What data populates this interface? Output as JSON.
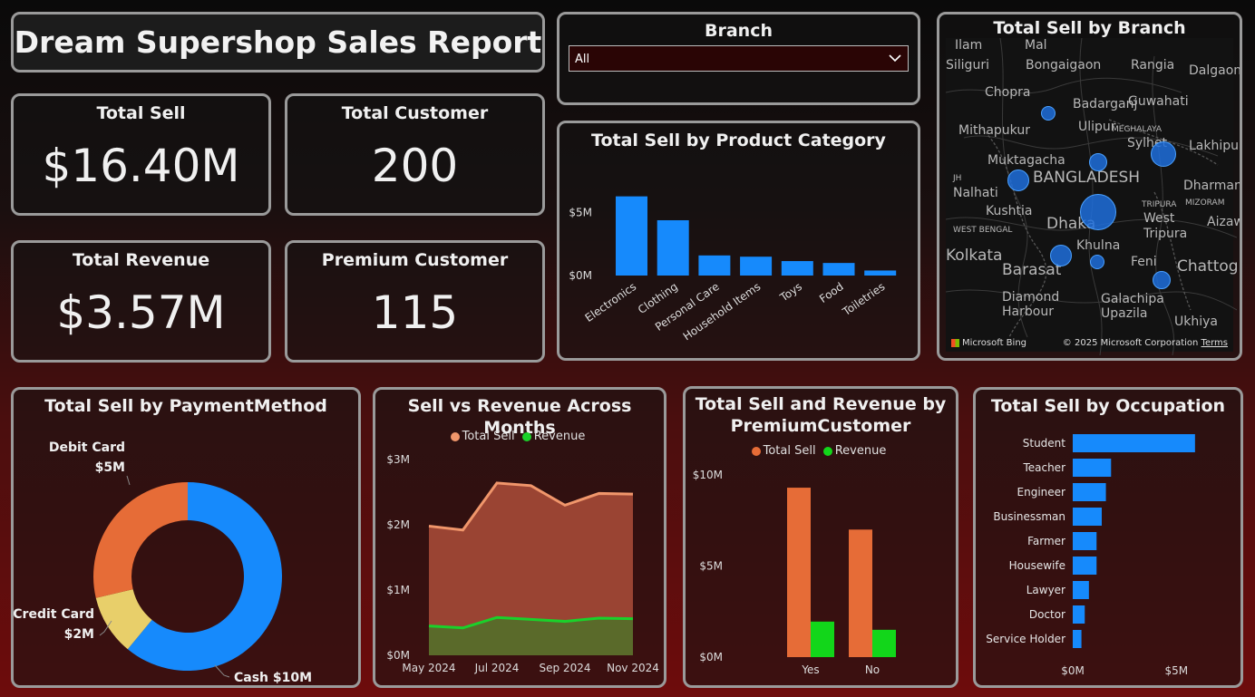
{
  "report": {
    "title": "Dream Supershop Sales Report"
  },
  "kpis": {
    "total_sell": {
      "label": "Total Sell",
      "value": "$16.40M"
    },
    "total_customer": {
      "label": "Total Customer",
      "value": "200"
    },
    "total_revenue": {
      "label": "Total Revenue",
      "value": "$3.57M"
    },
    "premium_customer": {
      "label": "Premium Customer",
      "value": "115"
    }
  },
  "branch_slicer": {
    "label": "Branch",
    "selected": "All",
    "icon": "chevron-down-icon"
  },
  "map": {
    "title": "Total Sell by Branch",
    "places": [
      {
        "name": "Ilam"
      },
      {
        "name": "Mal"
      },
      {
        "name": "Siliguri"
      },
      {
        "name": "Bongaigaon"
      },
      {
        "name": "Rangia"
      },
      {
        "name": "Dalgaon"
      },
      {
        "name": "Chopra"
      },
      {
        "name": "Badarganj"
      },
      {
        "name": "Guwahati"
      },
      {
        "name": "Mithapukur"
      },
      {
        "name": "Ulipur"
      },
      {
        "name": "MEGHALAYA"
      },
      {
        "name": "Sylhet"
      },
      {
        "name": "Lakhipur"
      },
      {
        "name": "JH"
      },
      {
        "name": "Muktagacha"
      },
      {
        "name": "BANGLADESH"
      },
      {
        "name": "Nalhati"
      },
      {
        "name": "Dharmana"
      },
      {
        "name": "MIZORAM"
      },
      {
        "name": "Kushtia"
      },
      {
        "name": "TRIPURA"
      },
      {
        "name": "WEST BENGAL"
      },
      {
        "name": "Dhaka"
      },
      {
        "name": "West"
      },
      {
        "name": "Tripura"
      },
      {
        "name": "Aizaw"
      },
      {
        "name": "Khulna"
      },
      {
        "name": "Kolkata"
      },
      {
        "name": "Barasat"
      },
      {
        "name": "Feni"
      },
      {
        "name": "Chattogra"
      },
      {
        "name": "Diamond"
      },
      {
        "name": "Harbour"
      },
      {
        "name": "Galachipa"
      },
      {
        "name": "Upazila"
      },
      {
        "name": "Ukhiya"
      }
    ],
    "attribution_logo": "Microsoft Bing",
    "copyright": "© 2025 Microsoft Corporation",
    "terms": "Terms"
  },
  "chart_data": [
    {
      "id": "category",
      "type": "bar",
      "title": "Total Sell by Product Category",
      "categories": [
        "Electronics",
        "Clothing",
        "Personal Care",
        "Household Items",
        "Toys",
        "Food",
        "Toiletries"
      ],
      "values": [
        6.3,
        4.4,
        1.6,
        1.5,
        1.15,
        1.0,
        0.4
      ],
      "unit": "M",
      "ylim": [
        0,
        7.5
      ],
      "yticks": [
        "$0M",
        "$5M"
      ],
      "color": "#168afc"
    },
    {
      "id": "payment",
      "type": "pie",
      "title": "Total Sell by PaymentMethod",
      "slices": [
        {
          "name": "Cash",
          "value": 10,
          "label": "Cash $10M",
          "color": "#168afc"
        },
        {
          "name": "Credit Card",
          "value": 1.7,
          "label_name": "Credit Card",
          "label_value": "$2M",
          "color": "#e8cf6a"
        },
        {
          "name": "Debit Card",
          "value": 4.7,
          "label_name": "Debit Card",
          "label_value": "$5M",
          "color": "#e66c37"
        }
      ]
    },
    {
      "id": "months",
      "type": "area",
      "title": "Sell vs Revenue Across Months",
      "x": [
        "May 2024",
        "Jun 2024",
        "Jul 2024",
        "Aug 2024",
        "Sep 2024",
        "Oct 2024",
        "Nov 2024"
      ],
      "xticks": [
        "May 2024",
        "Jul 2024",
        "Sep 2024",
        "Nov 2024"
      ],
      "series": [
        {
          "name": "Total Sell",
          "values": [
            1.98,
            1.92,
            2.64,
            2.6,
            2.3,
            2.48,
            2.47
          ],
          "color": "#f0966b"
        },
        {
          "name": "Revenue",
          "values": [
            0.45,
            0.42,
            0.58,
            0.55,
            0.52,
            0.57,
            0.56
          ],
          "color": "#1ad12a"
        }
      ],
      "ylim": [
        0,
        3
      ],
      "yticks": [
        "$0M",
        "$1M",
        "$2M",
        "$3M"
      ]
    },
    {
      "id": "premium",
      "type": "bar",
      "title": "Total Sell and Revenue by PremiumCustomer",
      "categories": [
        "Yes",
        "No"
      ],
      "series": [
        {
          "name": "Total Sell",
          "values": [
            9.3,
            7.0
          ],
          "color": "#e66c37"
        },
        {
          "name": "Revenue",
          "values": [
            1.95,
            1.5
          ],
          "color": "#12d61a"
        }
      ],
      "ylim": [
        0,
        10
      ],
      "yticks": [
        "$0M",
        "$5M",
        "$10M"
      ]
    },
    {
      "id": "occupation",
      "type": "bar",
      "orientation": "horizontal",
      "title": "Total Sell by Occupation",
      "categories": [
        "Student",
        "Teacher",
        "Engineer",
        "Businessman",
        "Farmer",
        "Housewife",
        "Lawyer",
        "Doctor",
        "Service Holder"
      ],
      "values": [
        5.9,
        1.85,
        1.6,
        1.4,
        1.15,
        1.15,
        0.78,
        0.58,
        0.42
      ],
      "xlim": [
        0,
        7
      ],
      "xticks": [
        "$0M",
        "$5M"
      ],
      "color": "#168afc"
    }
  ]
}
